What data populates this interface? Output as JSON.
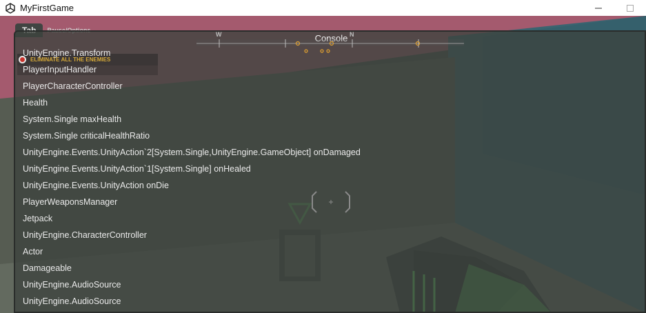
{
  "window": {
    "title": "MyFirstGame",
    "app_icon": "unity-icon",
    "controls": [
      "minimize-icon",
      "maximize-icon"
    ]
  },
  "hud": {
    "tab_label": "Tab",
    "tab_secondary": "Pause/Options",
    "compass_labels": [
      "W",
      "N"
    ],
    "objective": "ELIMINATE ALL THE ENEMIES",
    "objective_icon": "target-icon",
    "objective_color": "#d7aa38",
    "enemy_marker_color": "#e0a030"
  },
  "console": {
    "title": "Console",
    "entries": [
      "UnityEngine.Transform",
      "PlayerInputHandler",
      "PlayerCharacterController",
      "Health",
      "System.Single maxHealth",
      "System.Single criticalHealthRatio",
      "UnityEngine.Events.UnityAction`2[System.Single,UnityEngine.GameObject] onDamaged",
      "UnityEngine.Events.UnityAction`1[System.Single] onHealed",
      "UnityEngine.Events.UnityAction onDie",
      "PlayerWeaponsManager",
      "Jetpack",
      "UnityEngine.CharacterController",
      "Actor",
      "Damageable",
      "UnityEngine.AudioSource",
      "UnityEngine.AudioSource"
    ]
  },
  "scene": {
    "sky_color": "#a45a6e",
    "wall_color": "#3f6b76",
    "weapon_glow": "#5fd65f"
  }
}
